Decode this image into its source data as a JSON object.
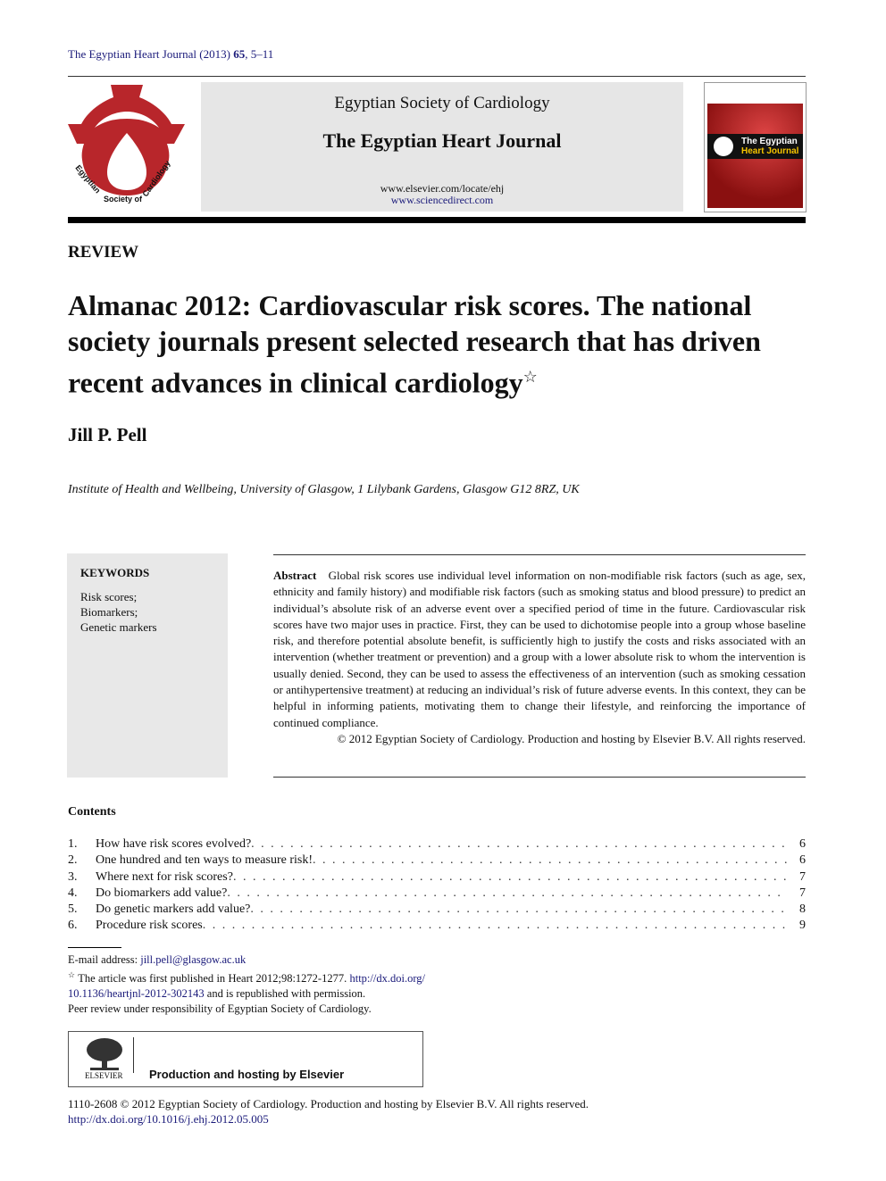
{
  "citation": {
    "journal_year": "The Egyptian Heart Journal (2013)",
    "volume": "65",
    "pages": ", 5–11"
  },
  "header": {
    "society": "Egyptian Society of Cardiology",
    "journal": "The Egyptian Heart Journal",
    "url1": "www.elsevier.com/locate/ehj",
    "url2": "www.sciencedirect.com",
    "logo_text": "Egyptian Society of Cardiology",
    "cover_title1": "The Egyptian",
    "cover_title2": "Heart Journal",
    "brand_color": "#b8262b"
  },
  "article": {
    "type": "REVIEW",
    "title": "Almanac 2012: Cardiovascular risk scores. The national society journals present selected research that has driven recent advances in clinical cardiology",
    "title_mark": "☆",
    "author": "Jill P. Pell",
    "affiliation": "Institute of Health and Wellbeing, University of Glasgow, 1 Lilybank Gardens, Glasgow G12 8RZ, UK"
  },
  "keywords": {
    "heading": "KEYWORDS",
    "items": [
      "Risk scores;",
      "Biomarkers;",
      "Genetic markers"
    ]
  },
  "abstract": {
    "label": "Abstract",
    "text": "Global risk scores use individual level information on non-modifiable risk factors (such as age, sex, ethnicity and family history) and modifiable risk factors (such as smoking status and blood pressure) to predict an individual’s absolute risk of an adverse event over a specified period of time in the future. Cardiovascular risk scores have two major uses in practice. First, they can be used to dichotomise people into a group whose baseline risk, and therefore potential absolute benefit, is sufficiently high to justify the costs and risks associated with an intervention (whether treatment or prevention) and a group with a lower absolute risk to whom the intervention is usually denied. Second, they can be used to assess the effectiveness of an intervention (such as smoking cessation or antihypertensive treatment) at reducing an individual’s risk of future adverse events. In this context, they can be helpful in informing patients, motivating them to change their lifestyle, and reinforcing the importance of continued compliance.",
    "copyright": "© 2012 Egyptian Society of Cardiology. Production and hosting by Elsevier B.V. All rights reserved."
  },
  "contents": {
    "heading": "Contents",
    "items": [
      {
        "num": "1.",
        "title": "How have risk scores evolved?",
        "page": "6"
      },
      {
        "num": "2.",
        "title": "One hundred and ten ways to measure risk!",
        "page": "6"
      },
      {
        "num": "3.",
        "title": "Where next for risk scores?",
        "page": "7"
      },
      {
        "num": "4.",
        "title": "Do biomarkers add value?",
        "page": "7"
      },
      {
        "num": "5.",
        "title": "Do genetic markers add value?",
        "page": "8"
      },
      {
        "num": "6.",
        "title": "Procedure risk scores",
        "page": "9"
      }
    ]
  },
  "footnotes": {
    "email_label": "E-mail address: ",
    "email": "jill.pell@glasgow.ac.uk",
    "star": "☆",
    "note_pre": " The article was first published in Heart 2012;98:1272-1277. ",
    "note_link": "http://dx.doi.org/10.1136/heartjnl-2012-302143",
    "note_post": " and is republished with permission.",
    "peer": "Peer review under responsibility of Egyptian Society of Cardiology."
  },
  "elsevier": {
    "logo_text": "ELSEVIER",
    "text": "Production and hosting by Elsevier"
  },
  "bottom": {
    "issn": "1110-2608 © 2012 Egyptian Society of Cardiology. Production and hosting by Elsevier B.V. All rights reserved.",
    "doi": "http://dx.doi.org/10.1016/j.ehj.2012.05.005"
  }
}
